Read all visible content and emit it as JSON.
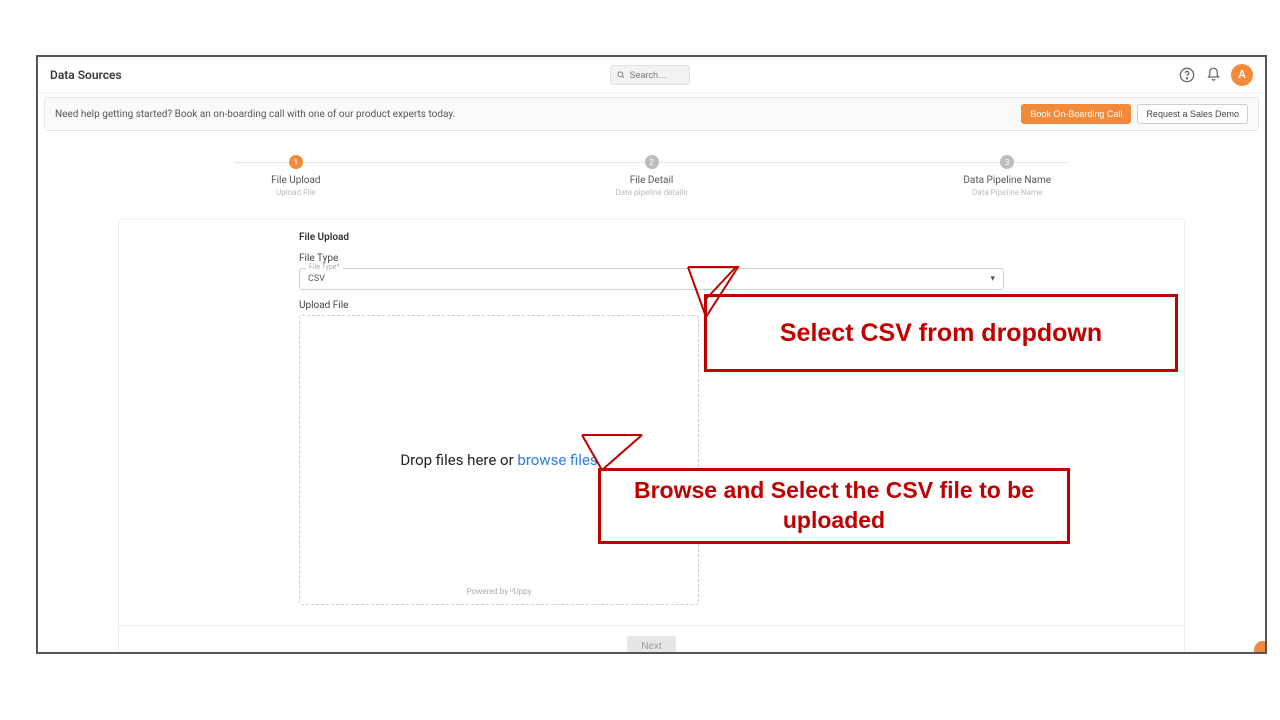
{
  "header": {
    "title": "Data Sources",
    "search_placeholder": "Search…",
    "avatar_initial": "A"
  },
  "banner": {
    "text": "Need help getting started? Book an on-boarding call with one of our product experts today.",
    "primary_btn": "Book On-Boarding Call",
    "secondary_btn": "Request a Sales Demo"
  },
  "stepper": {
    "steps": [
      {
        "num": "1",
        "label": "File Upload",
        "sub": "Upload File",
        "active": true
      },
      {
        "num": "2",
        "label": "File Detail",
        "sub": "Data pipeline details",
        "active": false
      },
      {
        "num": "3",
        "label": "Data Pipeline Name",
        "sub": "Data Pipeline Name",
        "active": false
      }
    ]
  },
  "form": {
    "section_title": "File Upload",
    "file_type_label": "File Type",
    "file_type_legend": "File Type*",
    "file_type_value": "CSV",
    "upload_label": "Upload File",
    "drop_text_prefix": "Drop files here or ",
    "drop_text_link": "browse files",
    "powered_by": "Powered by ᵁUppy",
    "next_label": "Next"
  },
  "annotations": {
    "callout1": "Select CSV  from dropdown",
    "callout2": "Browse and Select the CSV file to be uploaded"
  },
  "colors": {
    "accent": "#f28a3c",
    "annotation": "#c00000",
    "link": "#2b7de1"
  }
}
